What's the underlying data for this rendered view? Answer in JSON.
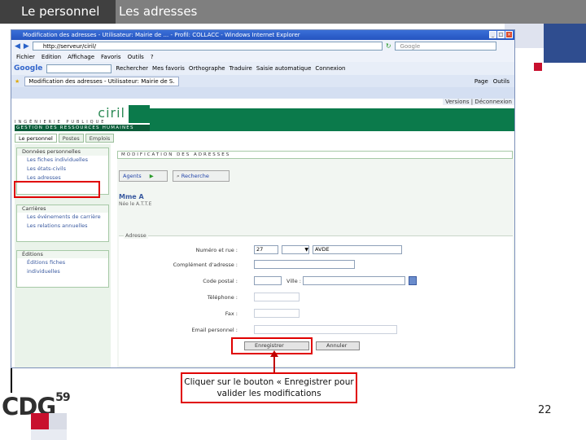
{
  "slide": {
    "title_left": "Le personnel",
    "title_right": "Les adresses",
    "page_number": "22",
    "callout": "Cliquer sur le bouton « Enregistrer pour valider les modifications",
    "logo_text": "CDG",
    "logo_superscript": "59"
  },
  "browser": {
    "window_title": "Modification des adresses - Utilisateur: Mairie de ...  - Profil: COLLACC - Windows Internet Explorer",
    "address": "http://serveur/ciril/",
    "search_placeholder": "Google",
    "menu": [
      "Fichier",
      "Edition",
      "Affichage",
      "Favoris",
      "Outils",
      "?"
    ],
    "google_toolbar": {
      "logo": "Google",
      "items": [
        "Rechercher",
        "Mes favoris",
        "Orthographe",
        "Traduire",
        "Saisie automatique",
        "Connexion"
      ]
    },
    "tab_label": "Modification des adresses - Utilisateur: Mairie de S.",
    "tab_tools": [
      "Page",
      "Outils"
    ]
  },
  "app": {
    "top_links": "Versions  |  Déconnexion",
    "logo": {
      "brand": "ciril",
      "line1": "INGÉNIERIE PUBLIQUE",
      "band": "GESTION DES RESSOURCES HUMAINES"
    },
    "tabs": [
      "Le personnel",
      "Postes",
      "Emplois"
    ],
    "sidebar": {
      "sections": [
        {
          "header": "Données personnelles",
          "items": [
            "Les fiches individuelles",
            "Les états-civils",
            "Les adresses"
          ]
        },
        {
          "header": "Carrières",
          "items": [
            "Les événements de carrière",
            "Les relations annuelles"
          ]
        },
        {
          "header": "Éditions",
          "items": [
            "Éditions fiches",
            "individuelles"
          ]
        }
      ]
    },
    "section_title": "MODIFICATION DES ADRESSES",
    "agents_label": "Agents",
    "recherche_label": "Recherche",
    "person_name": "Mme A",
    "person_sub": "Née le              A.T.T.E",
    "form": {
      "legend": "Adresse",
      "labels": {
        "numero": "Numéro et rue :",
        "complement": "Complément d'adresse :",
        "code_postal": "Code postal :",
        "ville": "Ville :",
        "telephone": "Téléphone :",
        "fax": "Fax :",
        "email": "Email personnel :"
      },
      "values": {
        "numero": "27",
        "voie": "AVDE"
      },
      "save_label": "Enregistrer",
      "cancel_label": "Annuler"
    }
  }
}
